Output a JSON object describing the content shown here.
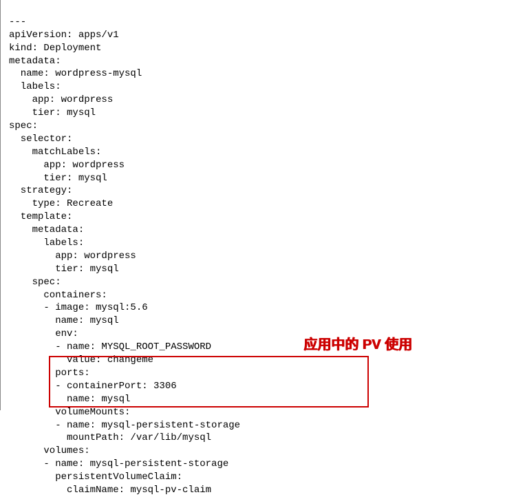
{
  "yaml": {
    "line1": "---",
    "line2": "apiVersion: apps/v1",
    "line3": "kind: Deployment",
    "line4": "metadata:",
    "line5": "  name: wordpress-mysql",
    "line6": "  labels:",
    "line7": "    app: wordpress",
    "line8": "    tier: mysql",
    "line9": "spec:",
    "line10": "  selector:",
    "line11": "    matchLabels:",
    "line12": "      app: wordpress",
    "line13": "      tier: mysql",
    "line14": "  strategy:",
    "line15": "    type: Recreate",
    "line16": "  template:",
    "line17": "    metadata:",
    "line18": "      labels:",
    "line19": "        app: wordpress",
    "line20": "        tier: mysql",
    "line21": "    spec:",
    "line22": "      containers:",
    "line23": "      - image: mysql:5.6",
    "line24": "        name: mysql",
    "line25": "        env:",
    "line26": "        - name: MYSQL_ROOT_PASSWORD",
    "line27": "          value: changeme",
    "line28": "        ports:",
    "line29": "        - containerPort: 3306",
    "line30": "          name: mysql",
    "line31": "        volumeMounts:",
    "line32": "        - name: mysql-persistent-storage",
    "line33": "          mountPath: /var/lib/mysql",
    "line34": "      volumes:",
    "line35": "      - name: mysql-persistent-storage",
    "line36": "        persistentVolumeClaim:",
    "line37": "          claimName: mysql-pv-claim"
  },
  "annotation": {
    "text": "应用中的 PV 使用"
  },
  "highlight": {
    "top": "517",
    "left": "70",
    "width": "465",
    "height": "75"
  },
  "annotation_pos": {
    "top": "488",
    "left": "440"
  }
}
